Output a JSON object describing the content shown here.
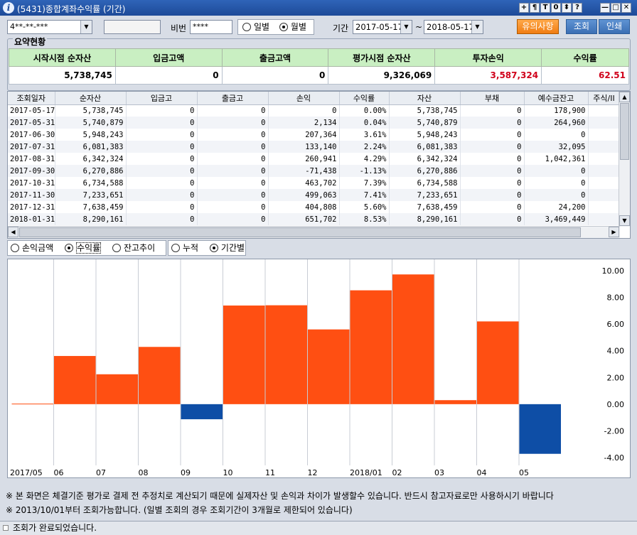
{
  "window": {
    "title": "(5431)종합계좌수익률 (기간)"
  },
  "titlebar_buttons": [
    "+",
    "¶",
    "T",
    "0",
    "⬍",
    "?",
    "—",
    "□",
    "✕"
  ],
  "account": {
    "number_display": "4**-**-***",
    "name_display": "",
    "password_label": "비번",
    "password_value": "****"
  },
  "period_mode": {
    "options": [
      "일별",
      "월별"
    ],
    "selected": "월별"
  },
  "date_range": {
    "label": "기간",
    "start": "2017-05-17",
    "separator": "~",
    "end": "2018-05-17"
  },
  "buttons": {
    "notice": "유의사항",
    "query": "조회",
    "print": "인쇄"
  },
  "summary": {
    "title": "요약현황",
    "headers": [
      "시작시점 순자산",
      "입금고액",
      "출금고액",
      "평가시점 순자산",
      "투자손익",
      "수익률"
    ],
    "values": [
      "5,738,745",
      "0",
      "0",
      "9,326,069",
      "3,587,324",
      "62.51"
    ]
  },
  "grid": {
    "headers": [
      "조회일자",
      "순자산",
      "입금고",
      "출금고",
      "손익",
      "수익률",
      "자산",
      "부채",
      "예수금잔고",
      "주식/II"
    ],
    "rows": [
      [
        "2017-05-17",
        "5,738,745",
        "0",
        "0",
        "0",
        "0.00%",
        "5,738,745",
        "0",
        "178,900",
        ""
      ],
      [
        "2017-05-31",
        "5,740,879",
        "0",
        "0",
        "2,134",
        "0.04%",
        "5,740,879",
        "0",
        "264,960",
        ""
      ],
      [
        "2017-06-30",
        "5,948,243",
        "0",
        "0",
        "207,364",
        "3.61%",
        "5,948,243",
        "0",
        "0",
        ""
      ],
      [
        "2017-07-31",
        "6,081,383",
        "0",
        "0",
        "133,140",
        "2.24%",
        "6,081,383",
        "0",
        "32,095",
        ""
      ],
      [
        "2017-08-31",
        "6,342,324",
        "0",
        "0",
        "260,941",
        "4.29%",
        "6,342,324",
        "0",
        "1,042,361",
        ""
      ],
      [
        "2017-09-30",
        "6,270,886",
        "0",
        "0",
        "-71,438",
        "-1.13%",
        "6,270,886",
        "0",
        "0",
        ""
      ],
      [
        "2017-10-31",
        "6,734,588",
        "0",
        "0",
        "463,702",
        "7.39%",
        "6,734,588",
        "0",
        "0",
        ""
      ],
      [
        "2017-11-30",
        "7,233,651",
        "0",
        "0",
        "499,063",
        "7.41%",
        "7,233,651",
        "0",
        "0",
        ""
      ],
      [
        "2017-12-31",
        "7,638,459",
        "0",
        "0",
        "404,808",
        "5.60%",
        "7,638,459",
        "0",
        "24,200",
        ""
      ],
      [
        "2018-01-31",
        "8,290,161",
        "0",
        "0",
        "651,702",
        "8.53%",
        "8,290,161",
        "0",
        "3,469,449",
        ""
      ]
    ]
  },
  "chart_options": {
    "metric": {
      "options": [
        "손익금액",
        "수익률",
        "잔고추이"
      ],
      "selected": "수익률"
    },
    "mode": {
      "options": [
        "누적",
        "기간별"
      ],
      "selected": "기간별"
    }
  },
  "chart_data": {
    "type": "bar",
    "categories": [
      "2017/05",
      "06",
      "07",
      "08",
      "09",
      "10",
      "11",
      "12",
      "2018/01",
      "02",
      "03",
      "04",
      "05"
    ],
    "values": [
      0.04,
      3.61,
      2.24,
      4.29,
      -1.13,
      7.39,
      7.41,
      5.6,
      8.53,
      9.72,
      0.3,
      6.2,
      -3.72
    ],
    "ylim": [
      -4.0,
      10.0
    ],
    "yticks": [
      "10.00",
      "8.00",
      "6.00",
      "4.00",
      "2.00",
      "0.00",
      "-2.00",
      "-4.00"
    ],
    "positive_color": "#ff4f12",
    "negative_color": "#0e4ea6",
    "grid": true
  },
  "notes": [
    "※ 본 화면은 체결기준 평가로 결제 전 추정치로 계산되기 때문에 실제자산 및 손익과 차이가 발생할수 있습니다. 반드시 참고자료로만 사용하시기 바랍니다",
    "※ 2013/10/01부터 조회가능합니다. (일별 조회의 경우 조회기간이 3개월로 제한되어 있습니다)"
  ],
  "status": {
    "message": "조회가 완료되었습니다."
  }
}
